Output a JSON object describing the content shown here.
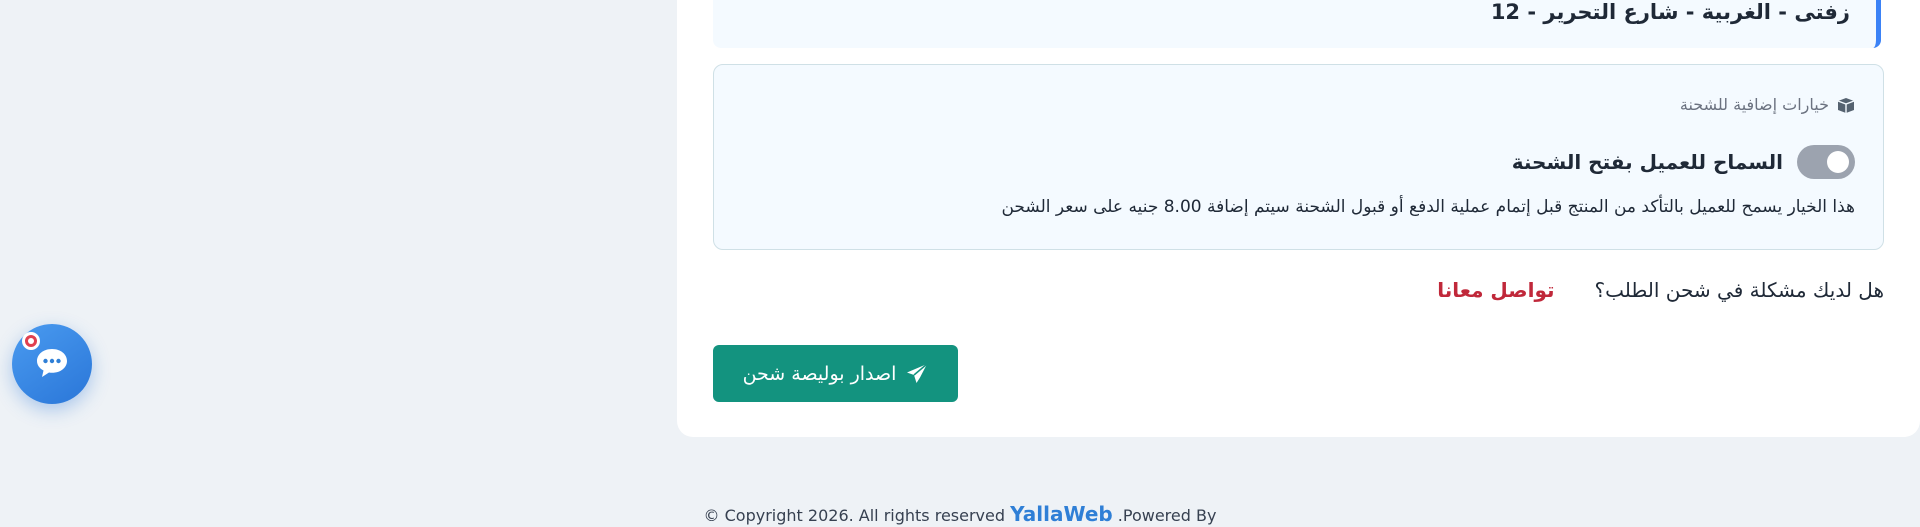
{
  "address": {
    "text": "زفتى - الغربية - شارع التحرير - 12"
  },
  "options": {
    "title": "خيارات إضافية للشحنة",
    "title_icon": "box-icon",
    "toggle_label": "السماح للعميل بفتح الشحنة",
    "toggle_on": false,
    "description": "هذا الخيار يسمح للعميل بالتأكد من المنتج قبل إتمام عملية الدفع أو قبول الشحنة سيتم إضافة 8.00 جنيه على سعر الشحن"
  },
  "help": {
    "question": "هل لديك مشكلة في شحن الطلب؟",
    "contact_link": "تواصل معانا"
  },
  "actions": {
    "issue_button": "اصدار بوليصة شحن",
    "issue_icon": "paper-plane-icon"
  },
  "chat": {
    "icon": "chat-bubble-icon",
    "badge_icon": "notification-dot-icon"
  },
  "footer": {
    "copyright": "© Copyright 2026. All rights reserved",
    "brand": "YallaWeb",
    "powered_by": ".Powered By"
  },
  "colors": {
    "accent": "#13937f",
    "link": "#c0283a",
    "brand": "#2f7fd6",
    "chat": "#2a76d8"
  }
}
